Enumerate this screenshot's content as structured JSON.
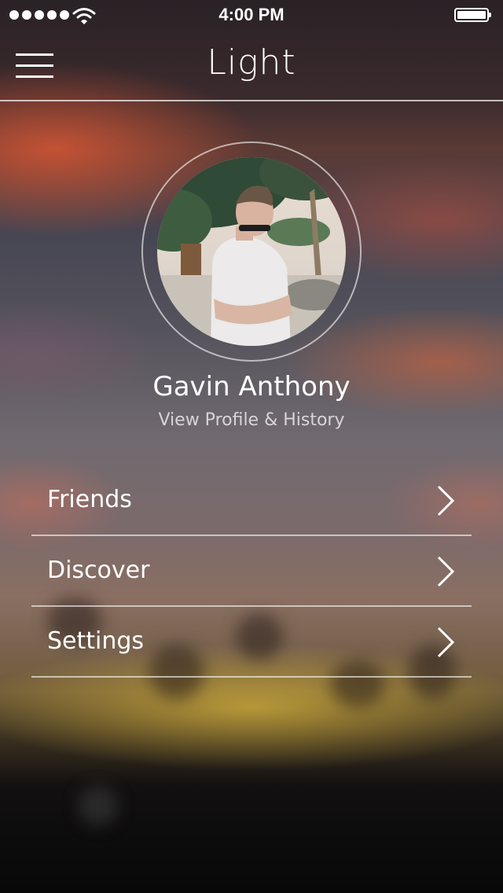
{
  "status_bar": {
    "time": "4:00 PM",
    "signal_bars": 5,
    "wifi_icon": "wifi-icon",
    "battery_icon": "battery-icon"
  },
  "nav": {
    "title": "Light",
    "menu_icon": "hamburger-menu-icon"
  },
  "profile": {
    "name": "Gavin Anthony",
    "link": "View Profile & History",
    "avatar": "avatar-photo"
  },
  "menu": {
    "items": [
      {
        "label": "Friends",
        "icon": "chevron-right-icon"
      },
      {
        "label": "Discover",
        "icon": "chevron-right-icon"
      },
      {
        "label": "Settings",
        "icon": "chevron-right-icon"
      }
    ]
  },
  "colors": {
    "text": "#ffffff",
    "divider": "#ffffffa0"
  }
}
